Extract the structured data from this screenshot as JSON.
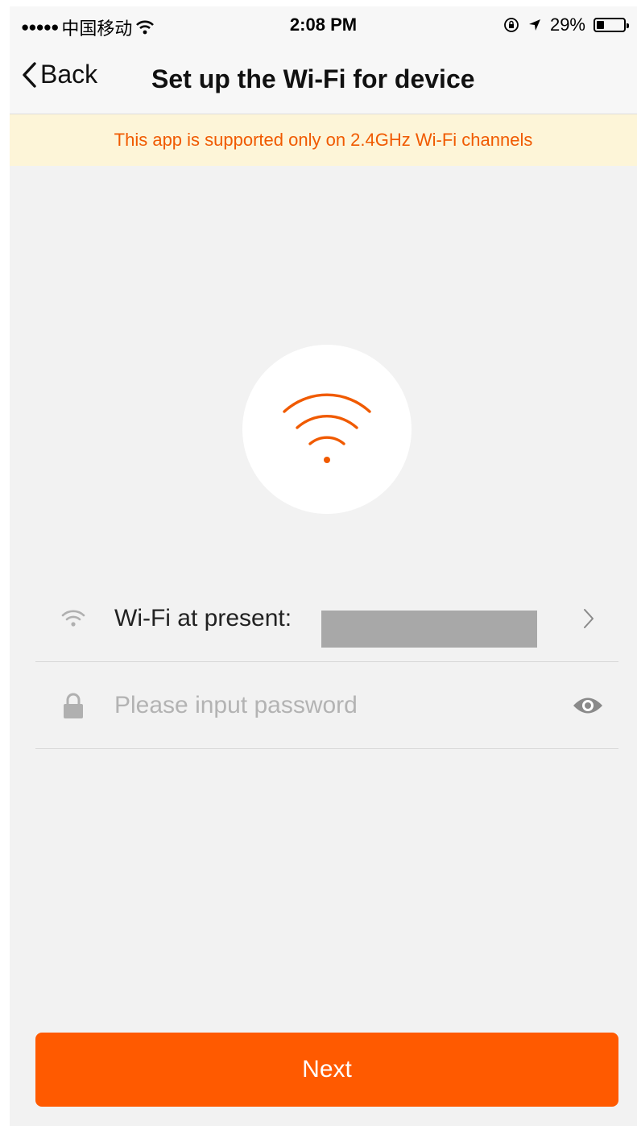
{
  "status_bar": {
    "carrier": "中国移动",
    "time": "2:08 PM",
    "battery": "29%",
    "battery_level": 0.29
  },
  "nav": {
    "back_label": "Back",
    "title": "Set up the Wi-Fi for device"
  },
  "banner": {
    "text": "This app is supported only on 2.4GHz Wi-Fi channels"
  },
  "form": {
    "wifi_label": "Wi-Fi at present:",
    "password_placeholder": "Please input password",
    "password_value": ""
  },
  "actions": {
    "next_label": "Next"
  },
  "colors": {
    "accent": "#ff5a00",
    "banner_bg": "#fdf5d8",
    "banner_text": "#f05a00"
  }
}
